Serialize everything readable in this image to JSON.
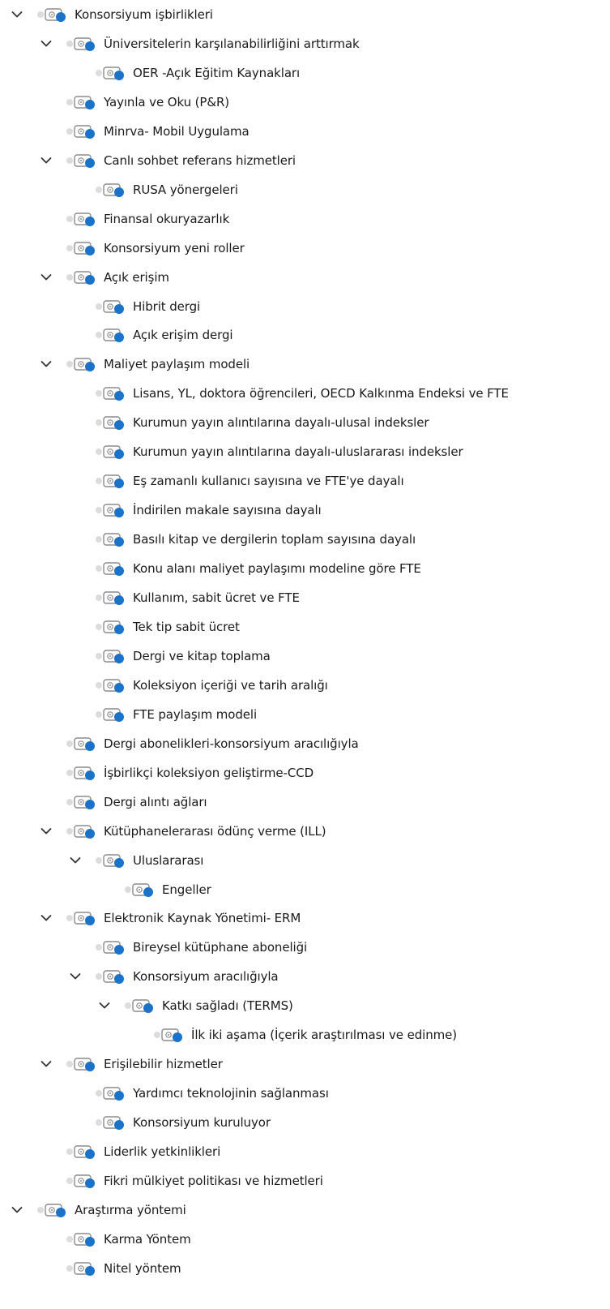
{
  "tree": [
    {
      "label": "Konsorsiyum işbirlikleri",
      "level": 0,
      "expanded": true
    },
    {
      "label": "Üniversitelerin karşılanabilirliğini arttırmak",
      "level": 1,
      "expanded": true
    },
    {
      "label": "OER -Açık Eğitim Kaynakları",
      "level": 2
    },
    {
      "label": "Yayınla ve Oku (P&R)",
      "level": 1
    },
    {
      "label": "Minrva- Mobil Uygulama",
      "level": 1
    },
    {
      "label": "Canlı sohbet referans hizmetleri",
      "level": 1,
      "expanded": true
    },
    {
      "label": "RUSA yönergeleri",
      "level": 2
    },
    {
      "label": "Finansal okuryazarlık",
      "level": 1
    },
    {
      "label": "Konsorsiyum yeni roller",
      "level": 1
    },
    {
      "label": "Açık erişim",
      "level": 1,
      "expanded": true
    },
    {
      "label": "Hibrit dergi",
      "level": 2
    },
    {
      "label": "Açık erişim dergi",
      "level": 2
    },
    {
      "label": "Maliyet paylaşım modeli",
      "level": 1,
      "expanded": true
    },
    {
      "label": "Lisans, YL, doktora öğrencileri, OECD Kalkınma Endeksi ve FTE",
      "level": 2
    },
    {
      "label": "Kurumun yayın alıntılarına dayalı-ulusal indeksler",
      "level": 2
    },
    {
      "label": "Kurumun yayın alıntılarına dayalı-uluslararası indeksler",
      "level": 2
    },
    {
      "label": "Eş zamanlı kullanıcı sayısına ve FTE'ye dayalı",
      "level": 2
    },
    {
      "label": "İndirilen makale sayısına dayalı",
      "level": 2
    },
    {
      "label": "Basılı kitap ve dergilerin toplam sayısına dayalı",
      "level": 2
    },
    {
      "label": "Konu alanı maliyet paylaşımı modeline göre FTE",
      "level": 2
    },
    {
      "label": "Kullanım, sabit ücret ve FTE",
      "level": 2
    },
    {
      "label": "Tek tip sabit ücret",
      "level": 2
    },
    {
      "label": "Dergi ve kitap toplama",
      "level": 2
    },
    {
      "label": "Koleksiyon içeriği ve tarih aralığı",
      "level": 2
    },
    {
      "label": "FTE paylaşım modeli",
      "level": 2
    },
    {
      "label": "Dergi abonelikleri-konsorsiyum aracılığıyla",
      "level": 1
    },
    {
      "label": "İşbirlikçi koleksiyon geliştirme-CCD",
      "level": 1
    },
    {
      "label": "Dergi alıntı ağları",
      "level": 1
    },
    {
      "label": "Kütüphanelerarası ödünç verme (ILL)",
      "level": 1,
      "expanded": true
    },
    {
      "label": "Uluslararası",
      "level": 2,
      "expanded": true
    },
    {
      "label": "Engeller",
      "level": 3
    },
    {
      "label": "Elektronik Kaynak Yönetimi- ERM",
      "level": 1,
      "expanded": true
    },
    {
      "label": "Bireysel kütüphane aboneliği",
      "level": 2
    },
    {
      "label": "Konsorsiyum aracılığıyla",
      "level": 2,
      "expanded": true
    },
    {
      "label": "Katkı sağladı (TERMS)",
      "level": 3,
      "expanded": true
    },
    {
      "label": "İlk iki aşama (İçerik araştırılması ve edinme)",
      "level": 4
    },
    {
      "label": "Erişilebilir hizmetler",
      "level": 1,
      "expanded": true
    },
    {
      "label": "Yardımcı teknolojinin sağlanması",
      "level": 2
    },
    {
      "label": "Konsorsiyum kuruluyor",
      "level": 2
    },
    {
      "label": "Liderlik yetkinlikleri",
      "level": 1
    },
    {
      "label": "Fikri mülkiyet politikası ve hizmetleri",
      "level": 1
    },
    {
      "label": "Araştırma yöntemi",
      "level": 0,
      "expanded": true
    },
    {
      "label": "Karma Yöntem",
      "level": 1
    },
    {
      "label": "Nitel yöntem",
      "level": 1
    }
  ],
  "colors": {
    "icon_blue": "#1a73c8",
    "icon_gray": "#8c8c8c",
    "dot_gray": "#dcdcdc",
    "chevron": "#333333",
    "text": "#1a1a1a"
  },
  "icon_name": "code-node-icon"
}
